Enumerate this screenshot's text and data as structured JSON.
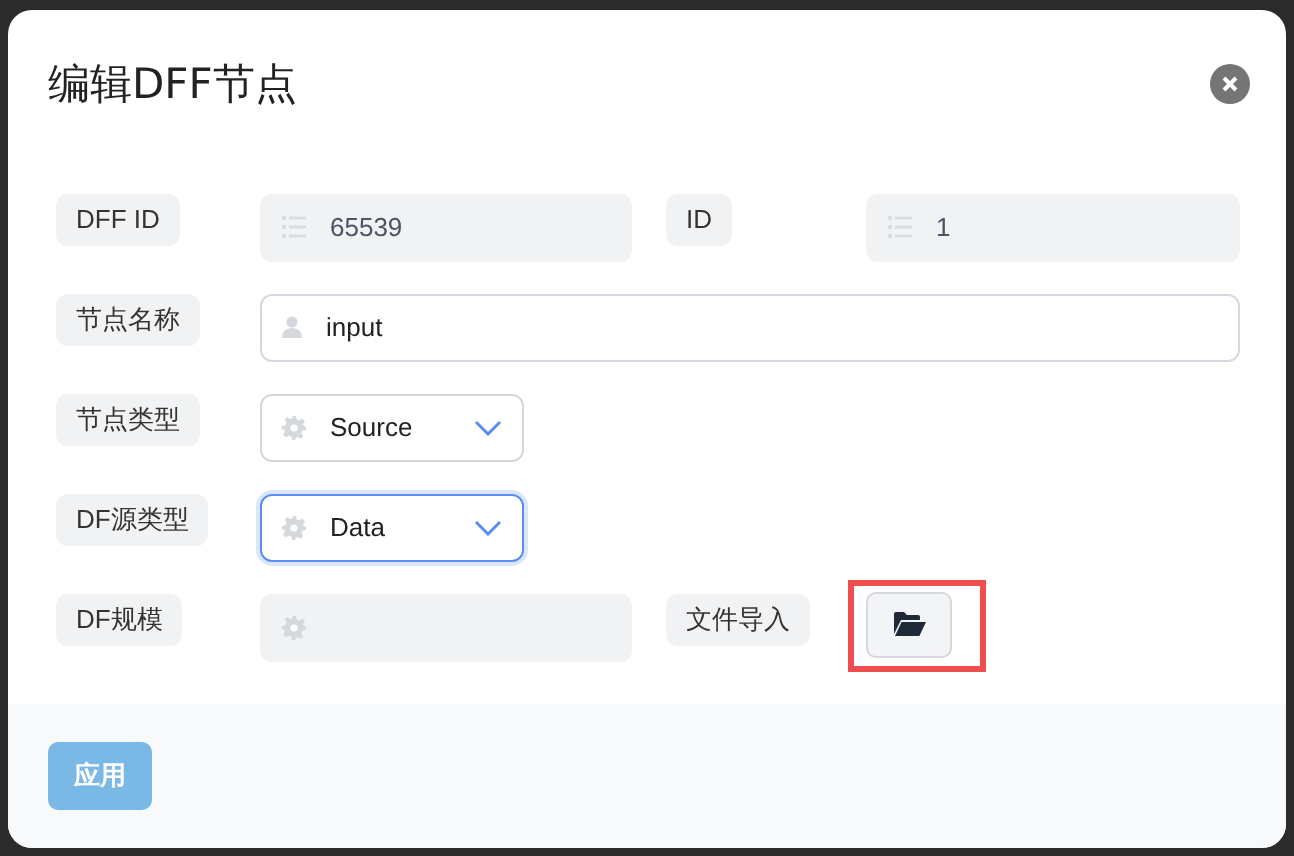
{
  "dialog": {
    "title": "编辑DFF节点"
  },
  "rows": [
    {
      "items": [
        {
          "label": "DFF ID",
          "field": {
            "kind": "text",
            "value": "65539",
            "disabled": true
          }
        },
        {
          "label": "ID",
          "field": {
            "kind": "text",
            "value": "1",
            "disabled": true
          }
        }
      ]
    },
    {
      "items": [
        {
          "label": "节点名称",
          "field": {
            "kind": "text",
            "value": "input",
            "disabled": false
          }
        }
      ]
    },
    {
      "items": [
        {
          "label": "节点类型",
          "field": {
            "kind": "select",
            "value": "Source",
            "focused": false
          }
        }
      ]
    },
    {
      "items": [
        {
          "label": "DF源类型",
          "field": {
            "kind": "select",
            "value": "Data",
            "focused": true
          }
        }
      ]
    },
    {
      "items": [
        {
          "label": "DF规模",
          "field": {
            "kind": "text",
            "disabled": true
          }
        },
        {
          "label": "文件导入",
          "field": {
            "kind": "file_button",
            "highlighted": true
          }
        }
      ]
    }
  ],
  "footer": {
    "apply": {
      "label": "应用",
      "disabled": true
    }
  }
}
